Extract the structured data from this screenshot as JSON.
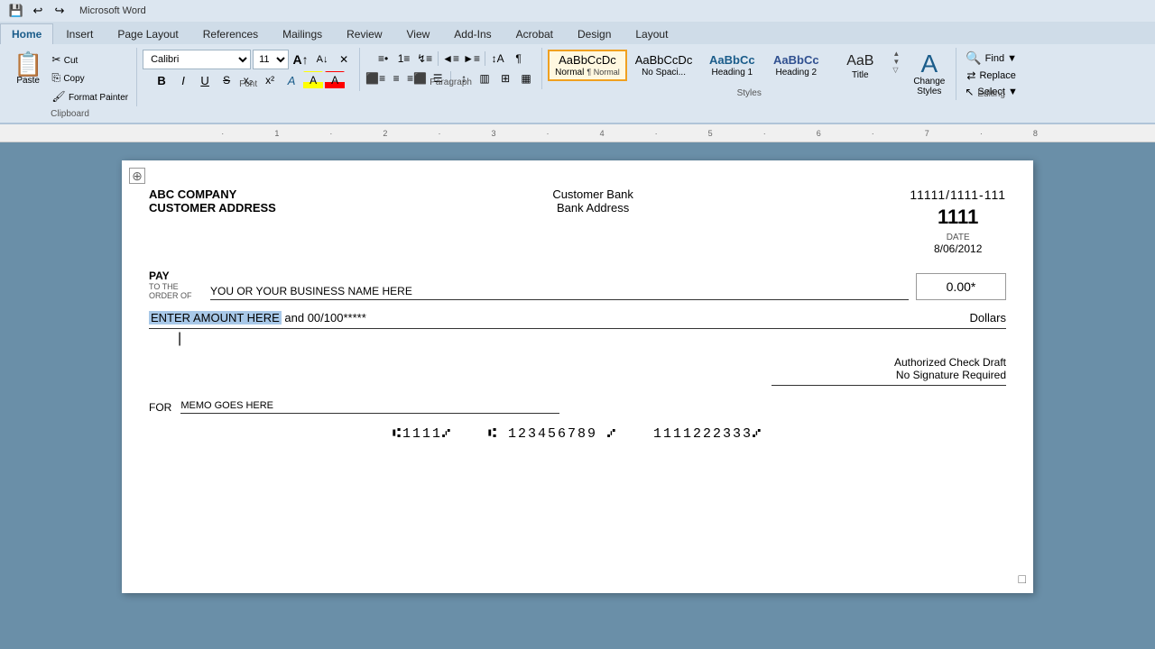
{
  "ribbon": {
    "tabs": [
      "Home",
      "Insert",
      "Page Layout",
      "References",
      "Mailings",
      "Review",
      "View",
      "Add-Ins",
      "Acrobat",
      "Design",
      "Layout"
    ],
    "active_tab": "Home"
  },
  "quick_access": {
    "save": "💾",
    "undo": "↩",
    "redo": "↪"
  },
  "clipboard": {
    "paste": "Paste",
    "cut": "Cut",
    "copy": "Copy",
    "format": "Format Painter"
  },
  "font_group": {
    "font_name": "Calibri",
    "font_size": "11",
    "grow": "A",
    "shrink": "a",
    "clear": "✕",
    "bold": "B",
    "italic": "I",
    "underline": "U",
    "strikethrough": "S",
    "subscript": "x₂",
    "superscript": "x²",
    "text_effects": "A",
    "highlight": "A",
    "font_color": "A",
    "label": "Font"
  },
  "paragraph_group": {
    "bullets": "≡",
    "numbering": "1≡",
    "multilevel": "↯≡",
    "decrease_indent": "◄≡",
    "increase_indent": "►≡",
    "sort": "↕A",
    "show_marks": "¶",
    "align_left": "≡",
    "align_center": "≡",
    "align_right": "≡",
    "justify": "≡",
    "columns": "▦",
    "line_spacing": "↕",
    "shading": "▥",
    "borders": "⊞",
    "label": "Paragraph"
  },
  "styles": {
    "items": [
      {
        "name": "Normal",
        "preview": "AaBbCcDc",
        "active": true
      },
      {
        "name": "No Spaci...",
        "preview": "AaBbCcDc",
        "active": false
      },
      {
        "name": "Heading 1",
        "preview": "AaBbCc",
        "active": false
      },
      {
        "name": "Heading 2",
        "preview": "AaBbCc",
        "active": false
      },
      {
        "name": "Title",
        "preview": "AaB",
        "active": false
      }
    ],
    "change_styles_label": "Change\nStyles",
    "label": "Styles"
  },
  "editing": {
    "find": "Find ▼",
    "replace": "Replace",
    "select": "Select ▼",
    "label": "Editing"
  },
  "ruler": {
    "marks": [
      "1",
      "2",
      "3",
      "4",
      "5",
      "6",
      "7",
      "8"
    ]
  },
  "check": {
    "move_handle": "⊕",
    "company": "ABC COMPANY",
    "address": "CUSTOMER ADDRESS",
    "bank_name": "Customer Bank",
    "bank_address": "Bank Address",
    "routing": "11111/1111-111",
    "check_number": "1111",
    "date_label": "DATE",
    "date": "8/06/2012",
    "pay_label": "PAY",
    "pay_to_label": "TO THE\nORDER OF",
    "payee": "YOU OR YOUR BUSINESS NAME HERE",
    "amount": "0.00*",
    "amount_words": "ENTER AMOUNT HERE",
    "amount_words_rest": " and 00/100*****",
    "dollars_label": "Dollars",
    "authorized_line1": "Authorized Check Draft",
    "authorized_line2": "No Signature Required",
    "for_label": "FOR",
    "memo": "MEMO GOES HERE",
    "micr_check": "⑆1111⑇",
    "micr_routing": "⑆ 123456789 ⑇",
    "micr_account": "1111222333⑇",
    "bottom_square": "□"
  }
}
